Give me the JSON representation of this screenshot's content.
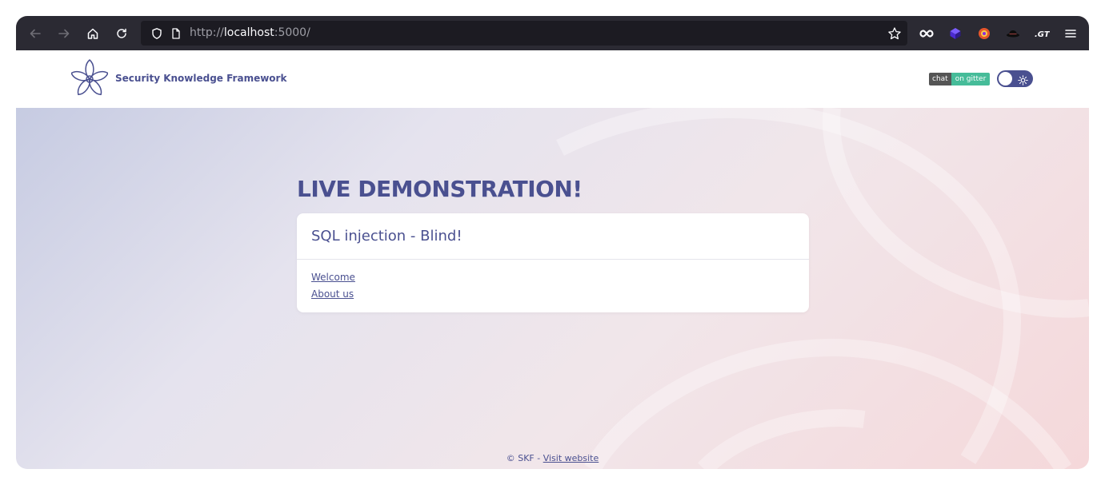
{
  "browser": {
    "url_prefix": "http://",
    "url_host": "localhost",
    "url_port": ":5000/"
  },
  "header": {
    "brand": "Security Knowledge Framework",
    "badge_left": "chat",
    "badge_right": "on gitter",
    "accent": "#4a5090",
    "badge_color": "#46bc99"
  },
  "main": {
    "heading": "LIVE DEMONSTRATION!",
    "card_title": "SQL injection - Blind!",
    "links": [
      "Welcome",
      "About us"
    ]
  },
  "footer": {
    "prefix": "© SKF - ",
    "link": "Visit website"
  },
  "icons": {
    "toolbar": [
      "back-icon",
      "forward-icon",
      "home-icon",
      "reload-icon",
      "shield-icon",
      "page-icon",
      "star-icon",
      "infinity-extension-icon",
      "cube-extension-icon",
      "fox-extension-icon",
      "hat-extension-icon",
      "gt-extension-icon",
      "menu-icon"
    ],
    "brand": "flower-logo-icon",
    "toggle": "sun-icon"
  }
}
